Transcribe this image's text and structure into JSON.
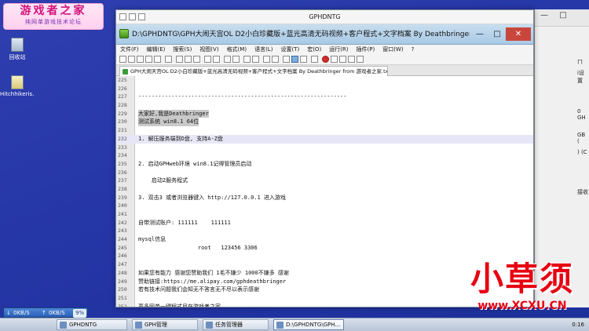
{
  "logo": {
    "title": "游戏者之家",
    "subtitle": "纯网单游戏技术论坛"
  },
  "desktop_icons": [
    {
      "label": "回收站",
      "icon": "recycle-bin-icon"
    },
    {
      "label": "Hitchhikeris...",
      "icon": "document-icon"
    }
  ],
  "outer_window": {
    "title": "GPHDNTG"
  },
  "window": {
    "title": "D:\\GPHDNTG\\GPH大闹天宫OL D2小白珍藏版+蓝光高清无码视频+客户程式+文字档案 By Deathbringer from 游戏者...",
    "tab": "GPH大闹天宫OL D2小白珍藏版+蓝光高清无码视频+客户程式+文字档案 By Deathbringer from 游戏者之家.txt"
  },
  "menu": [
    "文件(F)",
    "编辑(E)",
    "搜索(S)",
    "视图(V)",
    "格式(M)",
    "语言(L)",
    "设置(T)",
    "宏(O)",
    "运行(R)",
    "插件(P)",
    "窗口(W)",
    "?"
  ],
  "editor_lines": [
    {
      "n": "225",
      "t": ""
    },
    {
      "n": "226",
      "t": ""
    },
    {
      "n": "227",
      "t": "---------------------------------------------------------------"
    },
    {
      "n": "228",
      "t": ""
    },
    {
      "n": "229",
      "t": "大家好,我是Deathbringer",
      "sel": true
    },
    {
      "n": "230",
      "t": "测试系统 win8.1 64位",
      "sel": true
    },
    {
      "n": "231",
      "t": ""
    },
    {
      "n": "232",
      "t": "1. 解压服务端到D盘, 支持A-Z盘",
      "hl": true
    },
    {
      "n": "233",
      "t": ""
    },
    {
      "n": "234",
      "t": ""
    },
    {
      "n": "235",
      "t": "2. 启动GPHweb环境 win8.1记得管理员启动"
    },
    {
      "n": "236",
      "t": ""
    },
    {
      "n": "237",
      "t": "    启动2服务程式"
    },
    {
      "n": "238",
      "t": ""
    },
    {
      "n": "239",
      "t": "3. 双击3 或者浏览器键入 http://127.0.0.1 进入游戏"
    },
    {
      "n": "240",
      "t": ""
    },
    {
      "n": "241",
      "t": ""
    },
    {
      "n": "242",
      "t": "自带测试账户: 111111    111111"
    },
    {
      "n": "243",
      "t": ""
    },
    {
      "n": "244",
      "t": "mysql信息"
    },
    {
      "n": "245",
      "t": "                  root   123456 3306"
    },
    {
      "n": "246",
      "t": ""
    },
    {
      "n": "247",
      "t": ""
    },
    {
      "n": "248",
      "t": "如果您有能力 感谢您赞助我们 1毛不嫌少 1000不嫌多 感谢"
    },
    {
      "n": "249",
      "t": "赞助链接:https://me.alipay.com/gphdeathbringer"
    },
    {
      "n": "250",
      "t": "若有技术问题我们会知无不答言无不尽以表示感谢"
    },
    {
      "n": "251",
      "t": ""
    },
    {
      "n": "252",
      "t": "更多网单一键程式尽在游戏者之家"
    },
    {
      "n": "253",
      "t": ""
    },
    {
      "n": "254",
      "t": "地址度娘会告诉你!"
    }
  ],
  "right_panel": {
    "lines": [
      "ㄇ",
      "i设置",
      "0 GH",
      "GB (",
      ") (C",
      "接收"
    ]
  },
  "brand": {
    "name": "小草须",
    "url": "www.XCXU.CN"
  },
  "network": {
    "down": "0KB/S",
    "up": "0KB/S",
    "percent": "9%"
  },
  "taskbar": {
    "items": [
      "GPHDNTG",
      "GPH管理",
      "任务管理器",
      "D:\\GPHDNTG\\GPH..."
    ],
    "clock": "0:16"
  }
}
